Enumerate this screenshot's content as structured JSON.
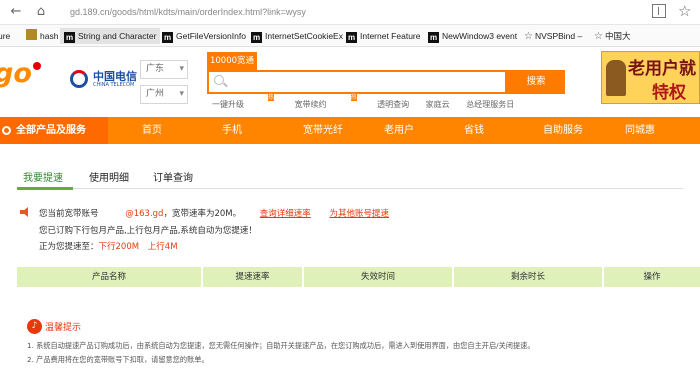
{
  "browser": {
    "url": "gd.189.cn/goods/html/kdts/main/orderIndex.html?link=wysy",
    "bookmarks": [
      {
        "label": "ure",
        "icon": ""
      },
      {
        "label": "hash",
        "icon": "folder-icon"
      },
      {
        "label": "String and Character",
        "icon": "m-icon"
      },
      {
        "label": "GetFileVersionInfo",
        "icon": "m-icon"
      },
      {
        "label": "InternetSetCookieEx",
        "icon": "m-icon"
      },
      {
        "label": "Internet Feature",
        "icon": "m-icon"
      },
      {
        "label": "NewWindow3 event",
        "icon": "m-icon"
      },
      {
        "label": "NVSPBind –",
        "icon": "star-icon"
      },
      {
        "label": "中国大",
        "icon": "star-icon"
      }
    ]
  },
  "header": {
    "logo_text": "go",
    "telecom_cn": "中国电信",
    "telecom_en": "CHINA TELECOM",
    "province": "广东",
    "city": "广州",
    "search_tab": "10000宽通",
    "search_placeholder": "",
    "search_button": "搜索",
    "hot_links": [
      "一键升级",
      "宽带续约",
      "透明查询",
      "家庭云",
      "总经理服务日"
    ],
    "hot_tag": "热",
    "ad_line1": "老用户就",
    "ad_line2": "特权"
  },
  "nav": {
    "all_products": "全部产品及服务",
    "items": [
      "首页",
      "手机",
      "宽带光纤",
      "老用户",
      "省钱",
      "自助服务",
      "同城惠"
    ]
  },
  "tabs": [
    "我要提速",
    "使用明细",
    "订单查询"
  ],
  "notice": {
    "account_label": "您当前宽带账号",
    "account": "@163.gd",
    "speed_text": "，宽带速率为20M。",
    "link_query": "查询详细速率",
    "link_other": "为其他账号提速",
    "line2": "您已订购下行包月产品,上行包月产品,系统自动为您提速！",
    "line3_label": "正为您提速至：",
    "down": "下行200M",
    "up": "上行4M"
  },
  "table": {
    "headers": [
      "产品名称",
      "提速速率",
      "失效时间",
      "剩余时长",
      "操作"
    ]
  },
  "tips": {
    "title": "温馨提示",
    "items": [
      "1. 系统自动提速产品订购成功后，由系统自动为您提速，您无需任何操作；自助开关提速产品，在您订购成功后，需进入到使用界面，由您自主开启/关闭提速。",
      "2. 产品费用将在您的宽带账号下扣取，请留意您的账单。"
    ]
  },
  "colors": {
    "accent": "#ff7b00",
    "nav": "#ff8400",
    "link_red": "#e8380d",
    "table_head": "#dff0b8",
    "tab_active": "#2e8b2e"
  }
}
